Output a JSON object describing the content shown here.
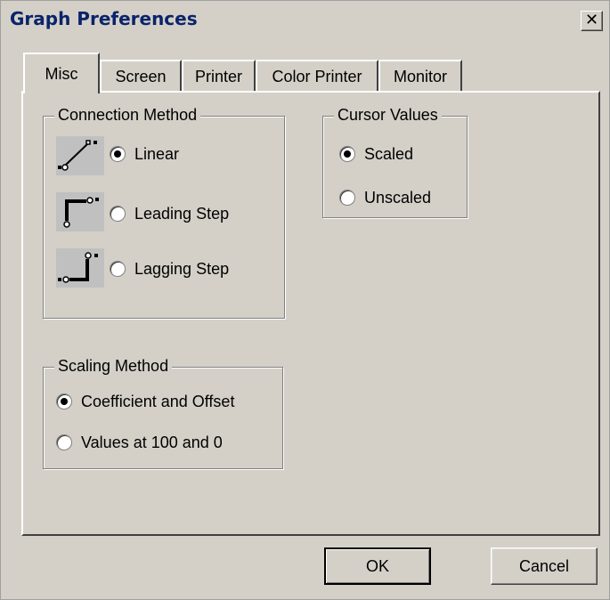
{
  "window": {
    "title": "Graph Preferences",
    "close_glyph": "✕"
  },
  "tabs": [
    {
      "label": "Misc",
      "active": true
    },
    {
      "label": "Screen",
      "active": false
    },
    {
      "label": "Printer",
      "active": false
    },
    {
      "label": "Color Printer",
      "active": false
    },
    {
      "label": "Monitor",
      "active": false
    }
  ],
  "connection_method": {
    "legend": "Connection Method",
    "options": [
      {
        "label": "Linear",
        "checked": true,
        "icon": "linear-connection-icon"
      },
      {
        "label": "Leading Step",
        "checked": false,
        "icon": "leading-step-icon"
      },
      {
        "label": "Lagging Step",
        "checked": false,
        "icon": "lagging-step-icon"
      }
    ]
  },
  "cursor_values": {
    "legend": "Cursor Values",
    "options": [
      {
        "label": "Scaled",
        "checked": true
      },
      {
        "label": "Unscaled",
        "checked": false
      }
    ]
  },
  "scaling_method": {
    "legend": "Scaling Method",
    "options": [
      {
        "label": "Coefficient and Offset",
        "checked": true
      },
      {
        "label": "Values at 100 and 0",
        "checked": false
      }
    ]
  },
  "buttons": {
    "ok": "OK",
    "cancel": "Cancel"
  }
}
